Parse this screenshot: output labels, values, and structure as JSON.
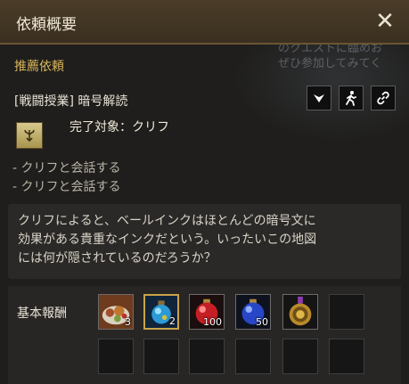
{
  "window": {
    "title": "依頼概要",
    "close_symbol": "✕"
  },
  "background_hint": {
    "line1": "のクエストに臨めお",
    "line2": "ぜひ参加してみてく"
  },
  "quest": {
    "section_title": "推薦依頼",
    "name": "[戦闘授業] 暗号解読",
    "target_label": "完了対象：クリフ",
    "objectives": [
      "- クリフと会話する",
      "- クリフと会話する"
    ],
    "description_lines": [
      "クリフによると、ベールインクはほとんどの暗号文に",
      "効果がある貴重なインクだという。いったいこの地図",
      "には何が隠されているのだろうか？"
    ],
    "action_icons": [
      "dropdown-icon",
      "walking-person-icon",
      "link-icon"
    ]
  },
  "rewards": {
    "label": "基本報酬",
    "items": [
      {
        "icon": "food-platter-icon",
        "count": "3"
      },
      {
        "icon": "blue-potion-icon",
        "count": "2"
      },
      {
        "icon": "red-potion-icon",
        "count": "100"
      },
      {
        "icon": "blue-elixir-icon",
        "count": "50"
      },
      {
        "icon": "golden-emblem-icon",
        "count": ""
      }
    ]
  },
  "colors": {
    "header_bg": "#4a3c28",
    "section_gold": "#d8b55a",
    "selected_slot_border": "#c9a349"
  }
}
